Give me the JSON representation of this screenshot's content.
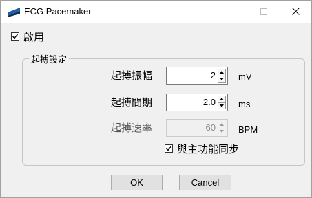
{
  "window": {
    "title": "ECG Pacemaker",
    "minimize_glyph": "—",
    "close_glyph": "✕"
  },
  "enable": {
    "label": "啟用",
    "checked": true
  },
  "group": {
    "title": "起搏設定",
    "fields": [
      {
        "label": "起搏振幅",
        "value": "2",
        "unit": "mV",
        "enabled": true
      },
      {
        "label": "起搏間期",
        "value": "2.0",
        "unit": "ms",
        "enabled": true
      },
      {
        "label": "起搏速率",
        "value": "60",
        "unit": "BPM",
        "enabled": false
      }
    ],
    "sync": {
      "label": "與主功能同步",
      "checked": true
    }
  },
  "buttons": {
    "ok": "OK",
    "cancel": "Cancel"
  },
  "icons": {
    "app": "ecg-app-icon",
    "minimize": "minimize-icon",
    "maximize": "maximize-icon",
    "close": "close-icon"
  },
  "colors": {
    "app_icon_blue": "#1f5fa8",
    "app_icon_dark": "#0b2e57"
  }
}
